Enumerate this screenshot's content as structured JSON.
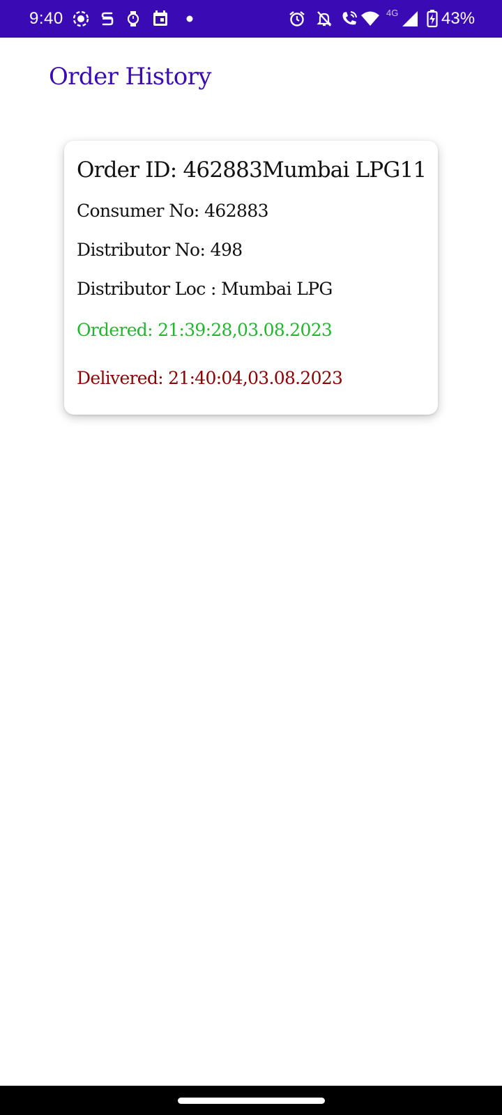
{
  "status_bar": {
    "time": "9:40",
    "network_label": "4G",
    "battery_percent": "43%",
    "left_icons": [
      "screen-record-icon",
      "s-app-icon",
      "watch-icon",
      "calendar-icon",
      "notification-dot-icon"
    ],
    "right_icons": [
      "alarm-icon",
      "bell-off-icon",
      "wifi-calling-icon",
      "wifi-icon",
      "cell-signal-icon",
      "battery-charging-icon"
    ],
    "background_color": "#3a0bb5"
  },
  "page": {
    "title": "Order History",
    "title_color": "#3a0bb5"
  },
  "orders": [
    {
      "order_id_line": "Order ID: 462883Mumbai LPG11",
      "consumer_line": "Consumer No: 462883",
      "distributor_no_line": "Distributor No: 498",
      "distributor_loc_line": "Distributor Loc : Mumbai LPG",
      "ordered_line": "Ordered:  21:39:28,03.08.2023",
      "delivered_line": "Delivered: 21:40:04,03.08.2023",
      "ordered_color": "#22b630",
      "delivered_color": "#8b0000"
    }
  ]
}
